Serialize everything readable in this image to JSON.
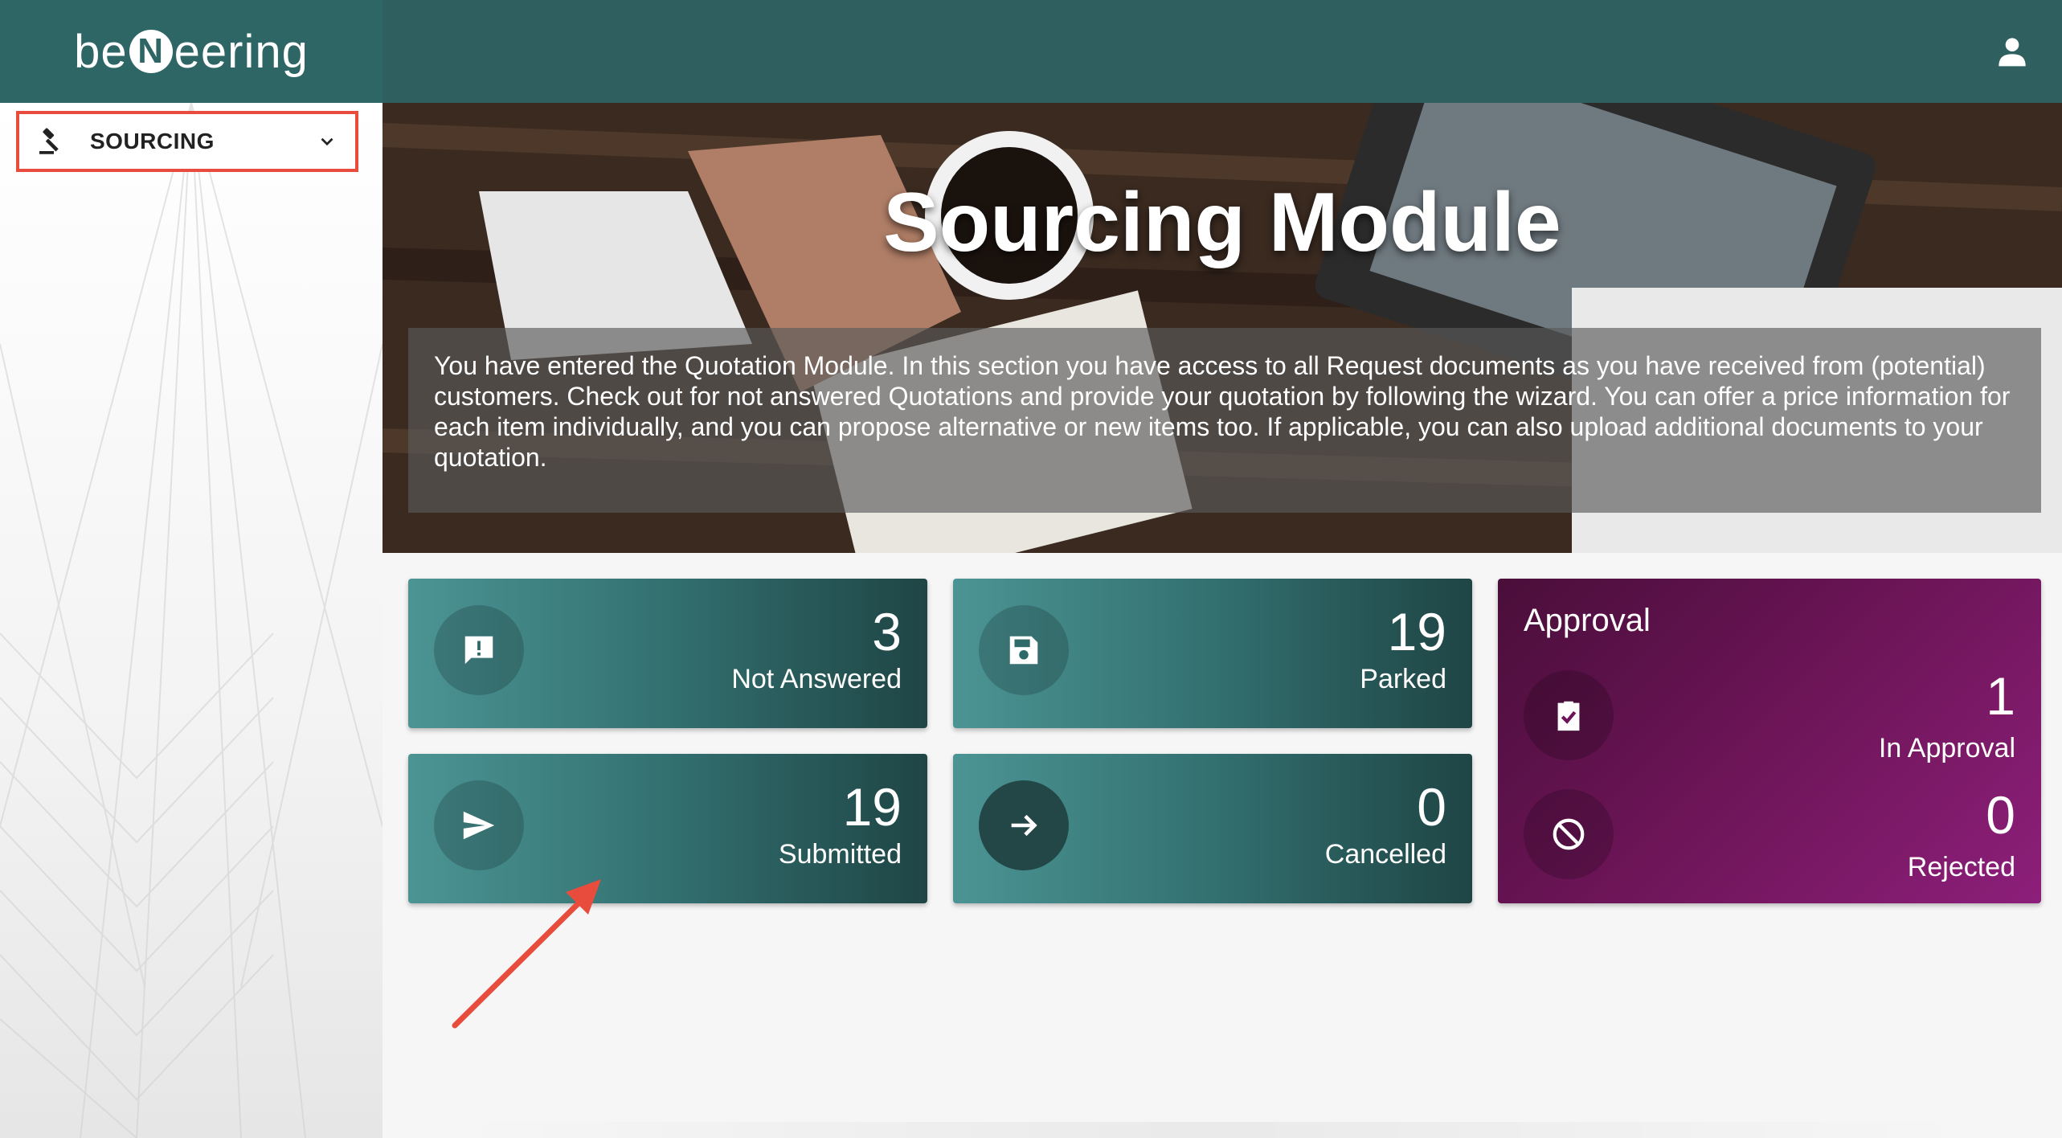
{
  "brand": {
    "name_prefix": "be",
    "name_mark": "N",
    "name_suffix": "eering"
  },
  "sidebar": {
    "items": [
      {
        "label": "SOURCING",
        "icon": "gavel-icon"
      }
    ]
  },
  "hero": {
    "title": "Sourcing Module",
    "description": "You have entered the Quotation Module. In this section you have access to all Request documents as you have received from (potential) customers. Check out for not answered Quotations and provide your quotation by following the wizard. You can offer a price information for each item individually, and you can propose alternative or new items too. If applicable, you can also upload additional documents to your quotation."
  },
  "cards": {
    "not_answered": {
      "count": "3",
      "label": "Not Answered",
      "icon": "alert-message-icon"
    },
    "parked": {
      "count": "19",
      "label": "Parked",
      "icon": "save-icon"
    },
    "submitted": {
      "count": "19",
      "label": "Submitted",
      "icon": "send-icon"
    },
    "cancelled": {
      "count": "0",
      "label": "Cancelled",
      "icon": "arrow-right-icon"
    }
  },
  "approval": {
    "title": "Approval",
    "in_approval": {
      "count": "1",
      "label": "In Approval",
      "icon": "clipboard-check-icon"
    },
    "rejected": {
      "count": "0",
      "label": "Rejected",
      "icon": "block-icon"
    }
  },
  "colors": {
    "topbar": "#2f5f5f",
    "teal_card": "#357474",
    "approval_card": "#6d1558",
    "highlight": "#e74c3c"
  }
}
